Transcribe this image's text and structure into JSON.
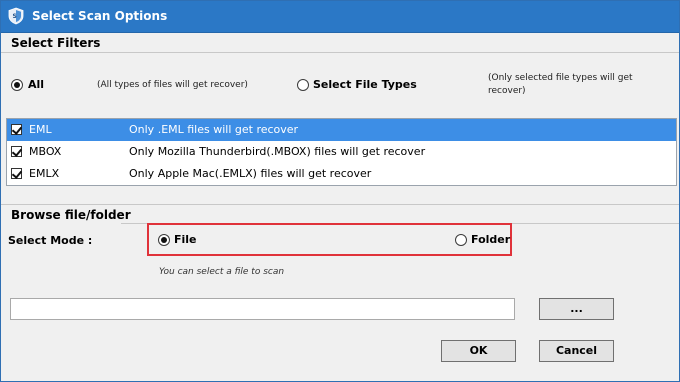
{
  "window": {
    "title": "Select Scan Options"
  },
  "filters": {
    "section_title": "Select Filters",
    "all_label": "All",
    "all_note": "(All types of files will get recover)",
    "select_types_label": "Select File Types",
    "select_types_note": "(Only selected file types will get recover)",
    "selected_option": "All"
  },
  "file_types": [
    {
      "ext": "EML",
      "desc": "Only .EML files will get recover",
      "checked": true,
      "selected": true
    },
    {
      "ext": "MBOX",
      "desc": "Only Mozilla Thunderbird(.MBOX) files will get recover",
      "checked": true,
      "selected": false
    },
    {
      "ext": "EMLX",
      "desc": "Only Apple Mac(.EMLX) files will get recover",
      "checked": true,
      "selected": false
    }
  ],
  "browse": {
    "section_title": "Browse file/folder",
    "mode_label": "Select Mode :",
    "file_label": "File",
    "folder_label": "Folder",
    "selected_mode": "File",
    "hint": "You can select a file to scan",
    "path_value": "",
    "browse_button": "...",
    "ok_button": "OK",
    "cancel_button": "Cancel"
  },
  "colors": {
    "titlebar": "#2b78c6",
    "selection": "#3d8ee6",
    "highlight_border": "#e0323a"
  }
}
